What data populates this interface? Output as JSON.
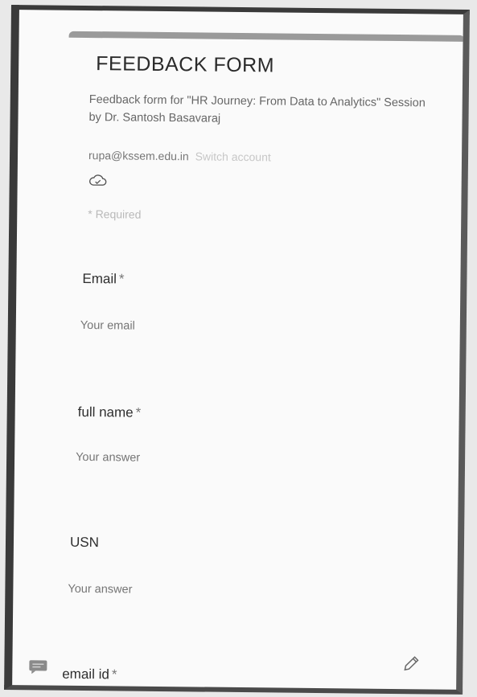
{
  "form": {
    "title": "FEEDBACK FORM",
    "description": "Feedback form for \"HR Journey: From Data to Analytics\" Session by Dr. Santosh Basavaraj",
    "account_email": "rupa@kssem.edu.in",
    "switch_account": "Switch account",
    "required_note": "* Required"
  },
  "questions": [
    {
      "label": "Email",
      "required_mark": "*",
      "placeholder": "Your email"
    },
    {
      "label": "full name",
      "required_mark": "*",
      "placeholder": "Your answer"
    },
    {
      "label": "USN",
      "required_mark": "",
      "placeholder": "Your answer"
    },
    {
      "label": "email id",
      "required_mark": "*"
    }
  ],
  "icons": {
    "cloud": "cloud-icon",
    "feedback": "chat-feedback-icon",
    "edit": "pencil-icon"
  }
}
